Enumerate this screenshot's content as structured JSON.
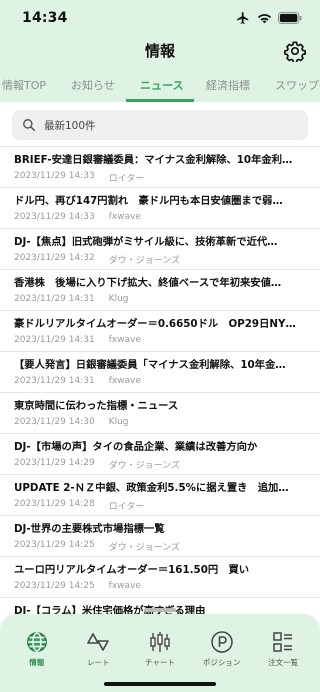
{
  "status": {
    "time": "14:34"
  },
  "header": {
    "title": "情報"
  },
  "tabs": [
    {
      "label": "情報TOP"
    },
    {
      "label": "お知らせ"
    },
    {
      "label": "ニュース",
      "active": true
    },
    {
      "label": "経済指標"
    },
    {
      "label": "スワップ一"
    }
  ],
  "search": {
    "placeholder": "最新100件"
  },
  "news": [
    {
      "title": "BRIEF-安達日銀審議委員：マイナス金利解除、10年金利…",
      "date": "2023/11/29 14:33",
      "source": "ロイター"
    },
    {
      "title": "ドル円、再び147円割れ　豪ドル円も本日安値圏まで弱…",
      "date": "2023/11/29 14:33",
      "source": "fxwave"
    },
    {
      "title": "DJ-【焦点】旧式砲弾がミサイル級に、技術革新で近代…",
      "date": "2023/11/29 14:32",
      "source": "ダウ・ジョーンズ"
    },
    {
      "title": "香港株　後場に入り下げ拡大、終値ベースで年初来安値…",
      "date": "2023/11/29 14:31",
      "source": "Klug"
    },
    {
      "title": "豪ドルリアルタイムオーダー＝0.6650ドル　OP29日NY…",
      "date": "2023/11/29 14:31",
      "source": "fxwave"
    },
    {
      "title": "【要人発言】日銀審議委員「マイナス金利解除、10年金…",
      "date": "2023/11/29 14:31",
      "source": "fxwave"
    },
    {
      "title": "東京時間に伝わった指標・ニュース",
      "date": "2023/11/29 14:30",
      "source": "Klug"
    },
    {
      "title": "DJ-【市場の声】タイの食品企業、業績は改善方向か",
      "date": "2023/11/29 14:29",
      "source": "ダウ・ジョーンズ"
    },
    {
      "title": "UPDATE 2-ＮＺ中銀、政策金利5.5%に据え置き　追加…",
      "date": "2023/11/29 14:28",
      "source": "ロイター"
    },
    {
      "title": "DJ-世界の主要株式市場指標一覧",
      "date": "2023/11/29 14:25",
      "source": "ダウ・ジョーンズ"
    },
    {
      "title": "ユーロ円リアルタイムオーダー＝161.50円　買い",
      "date": "2023/11/29 14:25",
      "source": "fxwave"
    },
    {
      "title": "DJ-【コラム】米住宅価格が高すぎる理由",
      "date": "",
      "source": ""
    }
  ],
  "bottom_nav": [
    {
      "label": "情報",
      "icon": "globe-icon",
      "active": true
    },
    {
      "label": "レート",
      "icon": "rate-icon"
    },
    {
      "label": "チャート",
      "icon": "candlestick-chart-icon"
    },
    {
      "label": "ポジション",
      "icon": "position-icon"
    },
    {
      "label": "注文一覧",
      "icon": "order-list-icon"
    }
  ],
  "colors": {
    "accent": "#3aa05a",
    "header_bg": "#dff3e4"
  }
}
